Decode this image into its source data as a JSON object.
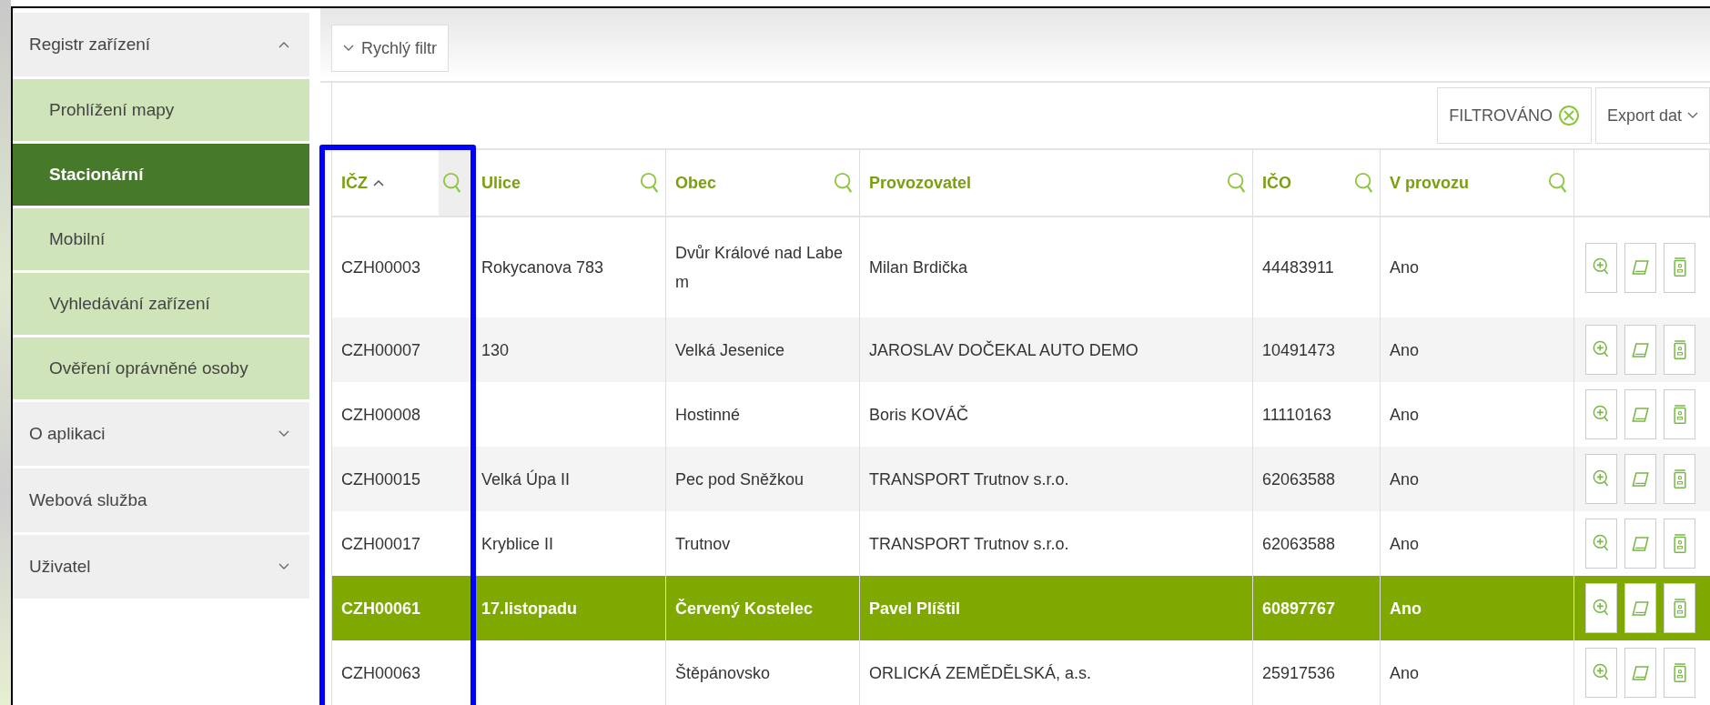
{
  "sidebar": {
    "items": [
      {
        "label": "Registr zařízení",
        "expanded": true,
        "children": [
          {
            "label": "Prohlížení mapy",
            "selected": false
          },
          {
            "label": "Stacionární",
            "selected": true
          },
          {
            "label": "Mobilní",
            "selected": false
          },
          {
            "label": "Vyhledávání zařízení",
            "selected": false
          },
          {
            "label": "Ověření oprávněné osoby",
            "selected": false
          }
        ]
      },
      {
        "label": "O aplikaci",
        "expanded": false
      },
      {
        "label": "Webová služba"
      },
      {
        "label": "Uživatel",
        "expanded": false
      }
    ]
  },
  "quick_filter": {
    "label": "Rychlý filtr",
    "expanded": false
  },
  "toolbar": {
    "filter_badge": "FILTROVÁNO",
    "export": "Export dat"
  },
  "table": {
    "columns": [
      {
        "label": "IČZ",
        "sorted": true
      },
      {
        "label": "Ulice"
      },
      {
        "label": "Obec"
      },
      {
        "label": "Provozovatel"
      },
      {
        "label": "IČO"
      },
      {
        "label": "V provozu"
      }
    ],
    "rows": [
      {
        "cells": [
          "CZH00003",
          "Rokycanova 783",
          "Dvůr Králové nad Labem",
          "Milan Brdička",
          "44483911",
          "Ano"
        ],
        "selected": false
      },
      {
        "cells": [
          "CZH00007",
          "130",
          "Velká Jesenice",
          "JAROSLAV DOČEKAL AUTO DEMO",
          "10491473",
          "Ano"
        ],
        "selected": false
      },
      {
        "cells": [
          "CZH00008",
          "",
          "Hostinné",
          "Boris KOVÁČ",
          "11110163",
          "Ano"
        ],
        "selected": false
      },
      {
        "cells": [
          "CZH00015",
          "Velká Úpa II",
          "Pec pod Sněžkou",
          "TRANSPORT Trutnov s.r.o.",
          "62063588",
          "Ano"
        ],
        "selected": false
      },
      {
        "cells": [
          "CZH00017",
          "Kryblice II",
          "Trutnov",
          "TRANSPORT Trutnov s.r.o.",
          "62063588",
          "Ano"
        ],
        "selected": false
      },
      {
        "cells": [
          "CZH00061",
          "17.listopadu",
          "Červený Kostelec",
          "Pavel Plíštil",
          "60897767",
          "Ano"
        ],
        "selected": true
      },
      {
        "cells": [
          "CZH00063",
          "",
          "Štěpánovsko",
          "ORLICKÁ ZEMĚDĚLSKÁ, a.s.",
          "25917536",
          "Ano"
        ],
        "selected": false
      }
    ]
  }
}
